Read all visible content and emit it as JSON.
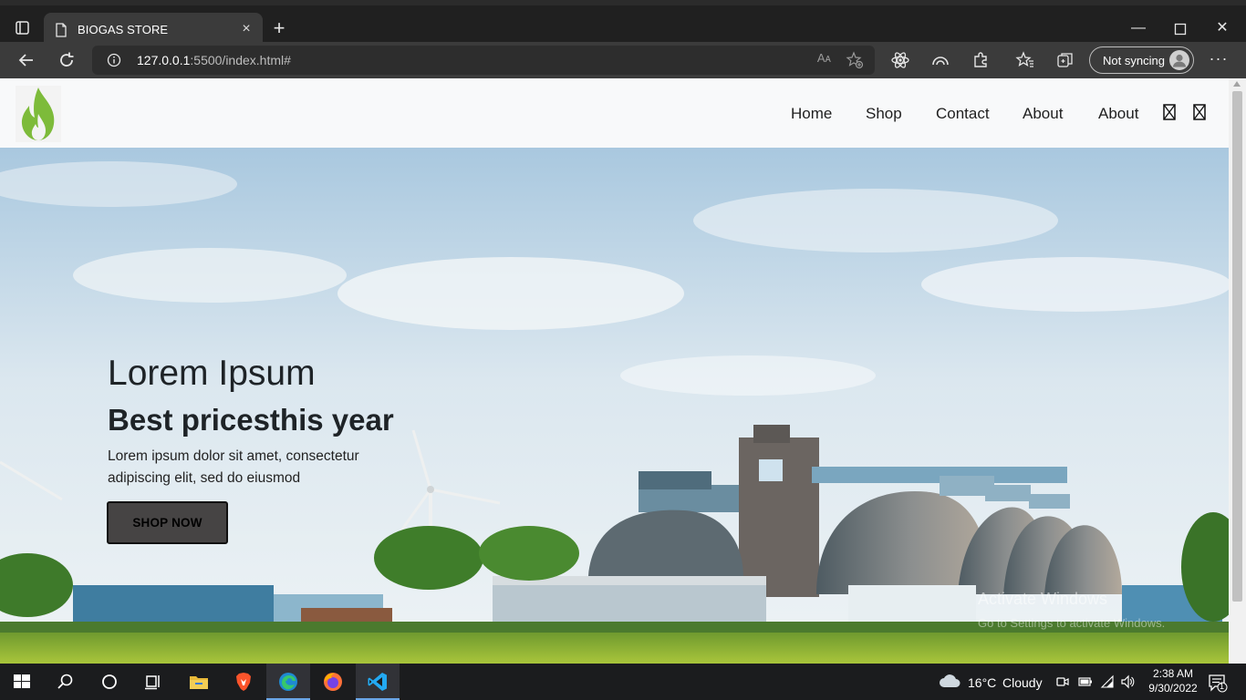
{
  "browser": {
    "tab_title": "BIOGAS STORE",
    "url_host": "127.0.0.1",
    "url_rest": ":5500/index.html#",
    "read_aloud": "Aᴀ",
    "sync_label": "Not syncing",
    "close_glyph": "×",
    "newtab_glyph": "+",
    "more_glyph": "···"
  },
  "window_controls": {
    "minimize": "—",
    "maximize": "☐",
    "close": "✕"
  },
  "site": {
    "nav": {
      "items": [
        "Home",
        "Shop",
        "Contact",
        "About",
        "About"
      ]
    },
    "hero": {
      "title": "Lorem Ipsum",
      "subtitle": "Best pricesthis year",
      "text": "Lorem ipsum dolor sit amet, consectetur adipiscing elit, sed do eiusmod",
      "button": "SHOP NOW"
    },
    "watermark": {
      "line1": "Activate Windows",
      "line2": "Go to Settings to activate Windows."
    }
  },
  "taskbar": {
    "weather_temp": "16°C",
    "weather_cond": "Cloudy",
    "time": "2:38 AM",
    "date": "9/30/2022",
    "notification_count": "1"
  },
  "colors": {
    "flame": "#7dbb3a",
    "button_bg": "#464444",
    "edge_blue": "#1f8ad2",
    "vscode_blue": "#23a9f2"
  }
}
